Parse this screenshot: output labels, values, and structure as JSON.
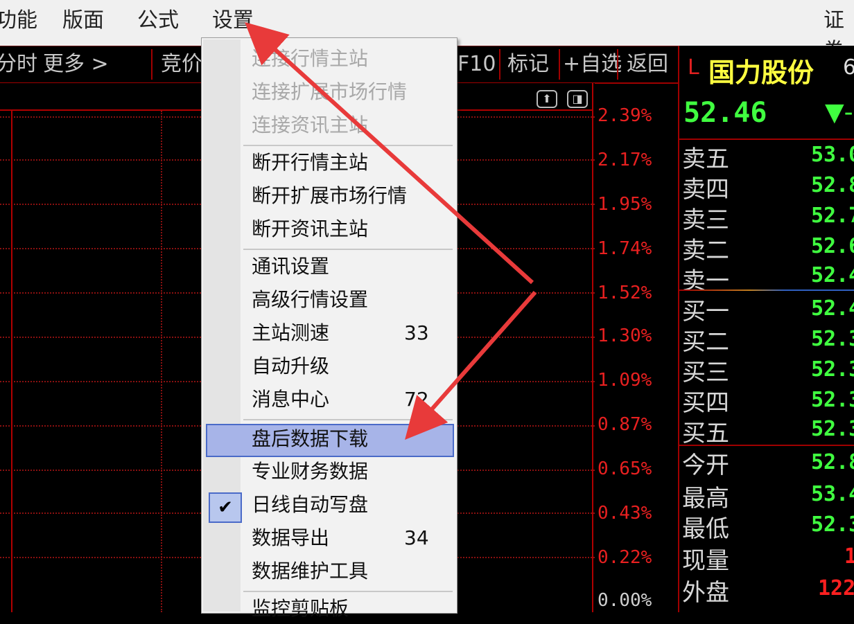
{
  "menubar": {
    "items": [
      "功能",
      "版面",
      "公式",
      "设置"
    ],
    "right": "证券"
  },
  "toolbar": {
    "items": [
      "分时",
      "更多 >",
      "竞价",
      "F10",
      "标记",
      "+自选",
      "返回"
    ]
  },
  "chart": {
    "percent_labels": [
      "2.39%",
      "2.17%",
      "1.95%",
      "1.74%",
      "1.52%",
      "1.30%",
      "1.09%",
      "0.87%",
      "0.65%",
      "0.43%",
      "0.22%",
      "0.00%"
    ]
  },
  "quote": {
    "marker": "L",
    "name": "国力股份",
    "code": "6",
    "price": "52.46",
    "change_arrow": "▼-",
    "sell": [
      {
        "label": "卖五",
        "value": "53.0"
      },
      {
        "label": "卖四",
        "value": "52.8"
      },
      {
        "label": "卖三",
        "value": "52.7"
      },
      {
        "label": "卖二",
        "value": "52.6"
      },
      {
        "label": "卖一",
        "value": "52.4"
      }
    ],
    "buy": [
      {
        "label": "买一",
        "value": "52.4"
      },
      {
        "label": "买二",
        "value": "52.3"
      },
      {
        "label": "买三",
        "value": "52.3"
      },
      {
        "label": "买四",
        "value": "52.3"
      },
      {
        "label": "买五",
        "value": "52.3"
      }
    ],
    "stats": [
      {
        "label": "今开",
        "value": "52.8"
      },
      {
        "label": "最高",
        "value": "53.4"
      },
      {
        "label": "最低",
        "value": "52.3"
      },
      {
        "label": "现量",
        "value": "1"
      },
      {
        "label": "外盘",
        "value": "122"
      }
    ]
  },
  "menu": {
    "items": [
      {
        "label": "连接行情主站",
        "disabled": true
      },
      {
        "label": "连接扩展市场行情",
        "disabled": true
      },
      {
        "label": "连接资讯主站",
        "disabled": true
      },
      {
        "label": "断开行情主站"
      },
      {
        "label": "断开扩展市场行情"
      },
      {
        "label": "断开资讯主站"
      },
      {
        "label": "通讯设置"
      },
      {
        "label": "高级行情设置"
      },
      {
        "label": "主站测速",
        "shortcut": "33"
      },
      {
        "label": "自动升级"
      },
      {
        "label": "消息中心",
        "shortcut": "72"
      },
      {
        "label": "盘后数据下载",
        "highlighted": true
      },
      {
        "label": "专业财务数据"
      },
      {
        "label": "日线自动写盘",
        "checked": true
      },
      {
        "label": "数据导出",
        "shortcut": "34"
      },
      {
        "label": "数据维护工具"
      },
      {
        "label": "监控剪贴板"
      }
    ],
    "check_glyph": "✔"
  },
  "colors": {
    "menu_highlight": "#a7b4e8",
    "grid_red": "#8a1010",
    "up_red": "#e82020",
    "down_green": "#40ff40",
    "title_yellow": "#ffff40",
    "annotation_arrow": "#e83a3a"
  }
}
